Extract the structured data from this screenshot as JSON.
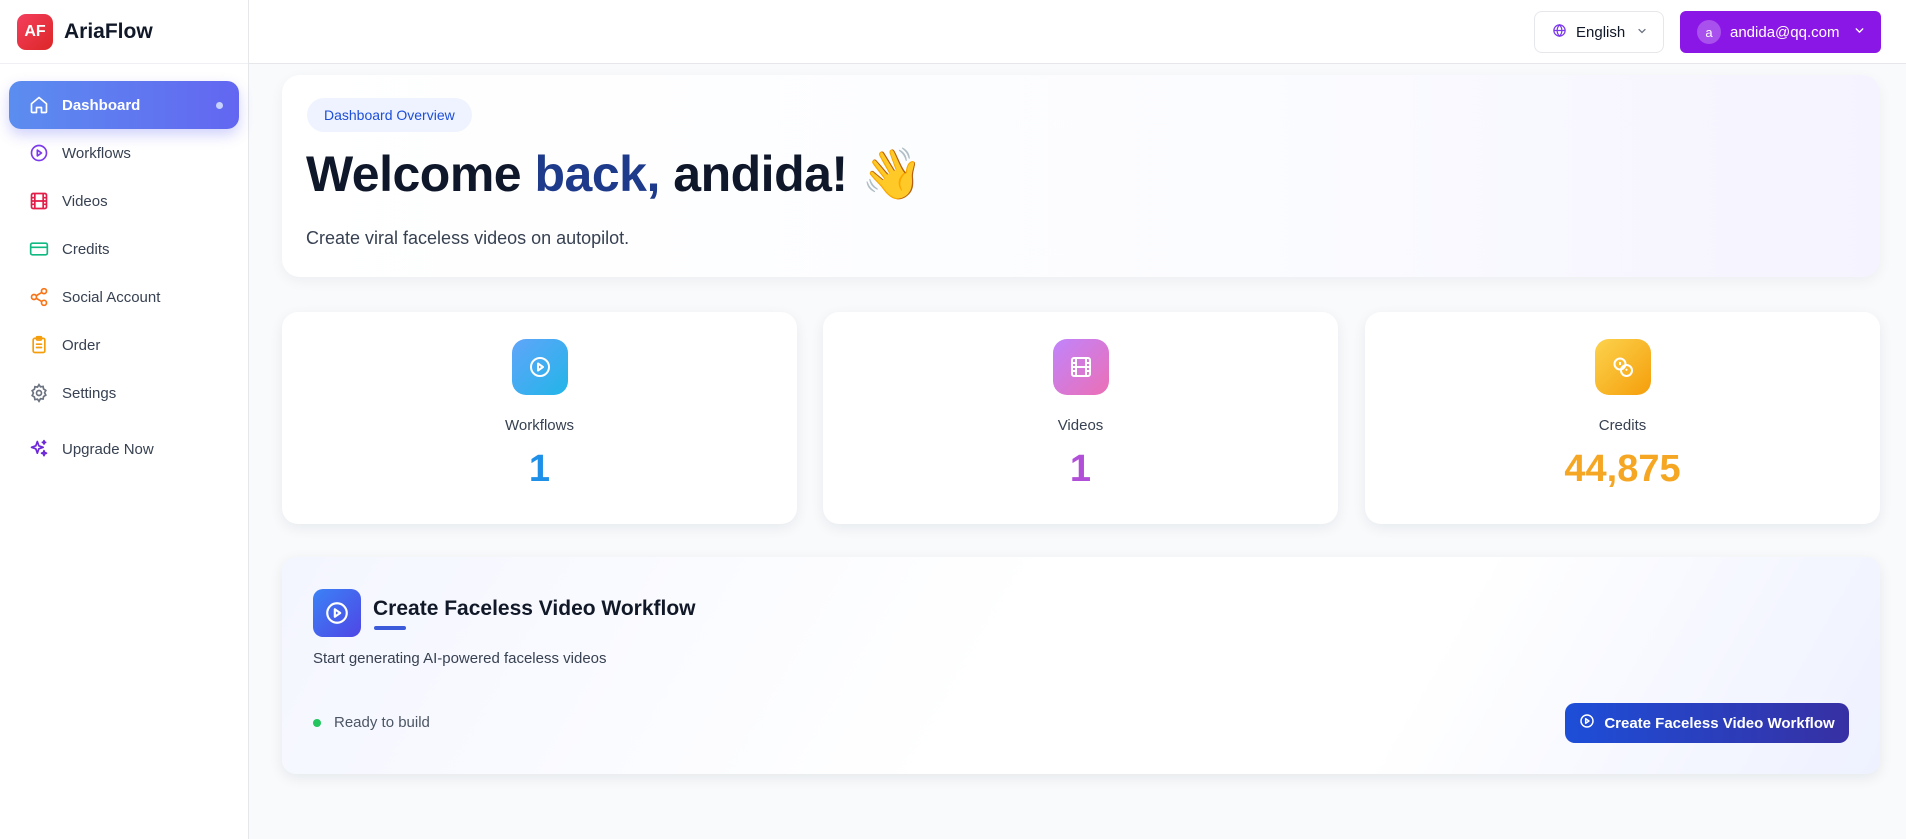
{
  "brand": {
    "logo_text": "AF",
    "name": "AriaFlow",
    "logo_color": "#ef4444"
  },
  "sidebar": {
    "items": [
      {
        "label": "Dashboard",
        "icon": "home-icon",
        "active": true
      },
      {
        "label": "Workflows",
        "icon": "play-circle-icon",
        "color": "#7c3aed"
      },
      {
        "label": "Videos",
        "icon": "film-icon",
        "color": "#e11d48"
      },
      {
        "label": "Credits",
        "icon": "credit-card-icon",
        "color": "#10b981"
      },
      {
        "label": "Social Account",
        "icon": "share-icon",
        "color": "#f97316"
      },
      {
        "label": "Order",
        "icon": "clipboard-icon",
        "color": "#f59e0b"
      },
      {
        "label": "Settings",
        "icon": "gear-icon",
        "color": "#6b7280"
      },
      {
        "label": "Upgrade Now",
        "icon": "sparkles-icon",
        "color": "#6d28d9"
      }
    ]
  },
  "header": {
    "language": {
      "label": "English",
      "icon": "globe-icon"
    },
    "user": {
      "avatar_letter": "a",
      "email": "andida@qq.com",
      "color": "#8b17e6"
    }
  },
  "hero": {
    "badge": "Dashboard Overview",
    "title_part1": "Welcome",
    "title_part2": "back,",
    "title_part3": "andida! 👋",
    "subtitle": "Create viral faceless videos on autopilot."
  },
  "stats": [
    {
      "label": "Workflows",
      "value": "1",
      "icon": "play-circle-icon",
      "color": "#1e90e8"
    },
    {
      "label": "Videos",
      "value": "1",
      "icon": "film-icon",
      "color": "#b14fd8"
    },
    {
      "label": "Credits",
      "value": "44,875",
      "icon": "coins-icon",
      "color": "#f5a623"
    }
  ],
  "create": {
    "title": "Create Faceless Video Workflow",
    "subtitle": "Start generating AI-powered faceless videos",
    "status": "Ready to build",
    "button_label": "Create Faceless Video Workflow"
  }
}
